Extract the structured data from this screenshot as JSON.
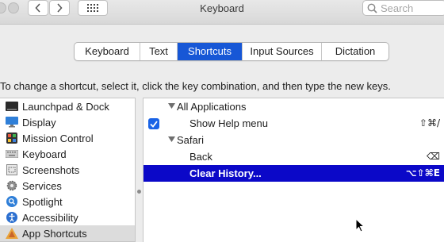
{
  "window": {
    "title": "Keyboard",
    "search_placeholder": "Search"
  },
  "tabs": [
    {
      "label": "Keyboard",
      "active": false
    },
    {
      "label": "Text",
      "active": false
    },
    {
      "label": "Shortcuts",
      "active": true
    },
    {
      "label": "Input Sources",
      "active": false
    },
    {
      "label": "Dictation",
      "active": false
    }
  ],
  "instruction": "To change a shortcut, select it, click the key combination, and then type the new keys.",
  "categories": [
    {
      "label": "Launchpad & Dock",
      "icon": "launchpad-icon"
    },
    {
      "label": "Display",
      "icon": "display-icon"
    },
    {
      "label": "Mission Control",
      "icon": "mission-control-icon"
    },
    {
      "label": "Keyboard",
      "icon": "keyboard-icon"
    },
    {
      "label": "Screenshots",
      "icon": "screenshots-icon"
    },
    {
      "label": "Services",
      "icon": "services-gear-icon"
    },
    {
      "label": "Spotlight",
      "icon": "spotlight-icon"
    },
    {
      "label": "Accessibility",
      "icon": "accessibility-icon"
    },
    {
      "label": "App Shortcuts",
      "icon": "app-shortcuts-icon",
      "selected": true
    }
  ],
  "shortcuts": [
    {
      "label": "All Applications",
      "type": "group"
    },
    {
      "label": "Show Help menu",
      "type": "item",
      "checked": true,
      "keys": "⇧⌘/"
    },
    {
      "label": "Safari",
      "type": "group"
    },
    {
      "label": "Back",
      "type": "item",
      "keys": "⌫"
    },
    {
      "label": "Clear History...",
      "type": "item",
      "keys": "⌥⇧⌘E",
      "selected": true
    }
  ],
  "colors": {
    "accent": "#1757d6",
    "selected_row": "#0b08c8"
  }
}
